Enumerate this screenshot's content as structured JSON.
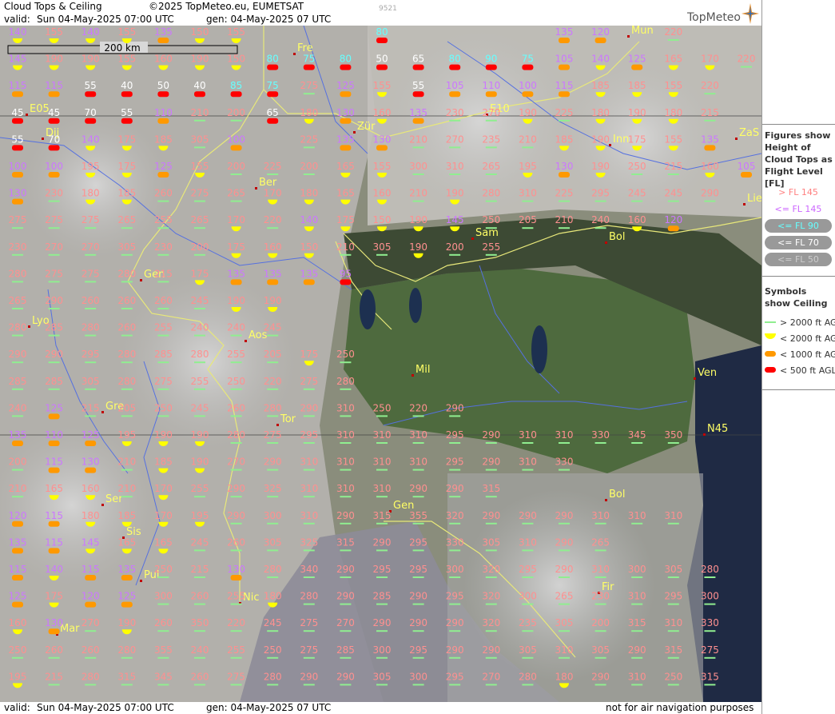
{
  "header": {
    "title": "Cloud Tops & Ceiling",
    "copyright": "©2025 TopMeteo.eu, EUMETSAT",
    "valid_label": "valid:",
    "valid_time": "Sun   04-May-2025   07:00 UTC",
    "gen_time": "gen: 04-May-2025 07 UTC",
    "image_id": "9521",
    "logo": "TopMeteo"
  },
  "footer": {
    "valid_label": "valid:",
    "valid_time": "Sun   04-May-2025   07:00 UTC",
    "gen_time": "gen: 04-May-2025 07 UTC",
    "disclaimer": "not for air navigation purposes"
  },
  "scale_bar": {
    "label": "200 km"
  },
  "legend": {
    "tops_title": "Figures show Height of Cloud Tops as Flight Level  [FL]",
    "tops_items": [
      {
        "label": "> FL 145",
        "color": "#ff8080"
      },
      {
        "label": "<= FL 145",
        "color": "#cc66ff"
      },
      {
        "label": "<= FL 90",
        "color": "#66ffff"
      },
      {
        "label": "<= FL 70",
        "color": "#ffffff"
      },
      {
        "label": "<= FL 50",
        "color": "#cccccc"
      }
    ],
    "ceiling_title": "Symbols show Ceiling",
    "ceiling_items": [
      {
        "label": "> 2000 ft AGL",
        "color": "#90ee90"
      },
      {
        "label": "< 2000 ft AGL",
        "color": "#ffff00"
      },
      {
        "label": "< 1000 ft AGL",
        "color": "#ff9900"
      },
      {
        "label": "< 500 ft AGL",
        "color": "#ff0000"
      }
    ]
  },
  "cities": [
    "Mun",
    "Fre",
    "Dij",
    "Zür",
    "Inn",
    "ZaS",
    "Ber",
    "Lie",
    "Sam",
    "Bol",
    "Gen",
    "Lyo",
    "Aos",
    "Mil",
    "Ven",
    "Gre",
    "Tor",
    "N45",
    "Bol",
    "Ser",
    "Gen",
    "Sis",
    "Pul",
    "Nic",
    "Fir",
    "Mar",
    "E05",
    "E10"
  ],
  "rows": [
    {
      "values": [
        "140",
        "155",
        "140",
        "155",
        "135",
        "150",
        "155",
        "",
        "",
        "",
        "80",
        "",
        "",
        "",
        "",
        "135",
        "120",
        "",
        "220"
      ]
    },
    {
      "values": [
        "145",
        "190",
        "190",
        "155",
        "160",
        "190",
        "150",
        "80",
        "75",
        "80",
        "50",
        "65",
        "80",
        "90",
        "75",
        "105",
        "140",
        "125",
        "165",
        "170",
        "220"
      ]
    },
    {
      "values": [
        "115",
        "115",
        "55",
        "40",
        "50",
        "40",
        "85",
        "75",
        "275",
        "125",
        "155",
        "55",
        "105",
        "110",
        "100",
        "115",
        "185",
        "185",
        "155",
        "220"
      ]
    },
    {
      "values": [
        "45",
        "45",
        "70",
        "55",
        "110",
        "210",
        "200",
        "65",
        "180",
        "130",
        "160",
        "135",
        "230",
        "270",
        "190",
        "225",
        "180",
        "190",
        "180",
        "215"
      ]
    },
    {
      "values": [
        "55",
        "70",
        "140",
        "175",
        "185",
        "305",
        "100",
        "",
        "225",
        "135",
        "130",
        "210",
        "270",
        "235",
        "210",
        "185",
        "190",
        "175",
        "155",
        "135"
      ]
    },
    {
      "values": [
        "100",
        "100",
        "195",
        "175",
        "125",
        "155",
        "200",
        "225",
        "200",
        "165",
        "155",
        "300",
        "310",
        "265",
        "195",
        "130",
        "190",
        "250",
        "215",
        "160",
        "105"
      ]
    },
    {
      "values": [
        "130",
        "230",
        "180",
        "185",
        "260",
        "275",
        "265",
        "170",
        "180",
        "165",
        "160",
        "210",
        "190",
        "280",
        "310",
        "225",
        "295",
        "245",
        "245",
        "290"
      ]
    },
    {
      "values": [
        "275",
        "275",
        "275",
        "265",
        "255",
        "265",
        "170",
        "220",
        "140",
        "175",
        "150",
        "190",
        "145",
        "250",
        "205",
        "210",
        "240",
        "160",
        "120"
      ]
    },
    {
      "values": [
        "230",
        "270",
        "270",
        "305",
        "230",
        "200",
        "175",
        "160",
        "150",
        "210",
        "305",
        "190",
        "200",
        "255"
      ]
    },
    {
      "values": [
        "280",
        "275",
        "275",
        "280",
        "215",
        "175",
        "135",
        "135",
        "135",
        "95"
      ]
    },
    {
      "values": [
        "265",
        "290",
        "260",
        "260",
        "260",
        "245",
        "190",
        "190"
      ]
    },
    {
      "values": [
        "280",
        "285",
        "280",
        "260",
        "255",
        "240",
        "240",
        "245"
      ]
    },
    {
      "values": [
        "290",
        "290",
        "295",
        "280",
        "285",
        "280",
        "255",
        "205",
        "175",
        "250"
      ]
    },
    {
      "values": [
        "285",
        "285",
        "305",
        "280",
        "275",
        "255",
        "250",
        "220",
        "275",
        "280"
      ]
    },
    {
      "values": [
        "240",
        "125",
        "215",
        "205",
        "250",
        "245",
        "260",
        "280",
        "290",
        "310",
        "250",
        "220",
        "290"
      ]
    },
    {
      "values": [
        "135",
        "110",
        "125",
        "195",
        "190",
        "190",
        "280",
        "275",
        "295",
        "310",
        "310",
        "310",
        "295",
        "290",
        "310",
        "310",
        "330",
        "345",
        "350"
      ]
    },
    {
      "values": [
        "200",
        "115",
        "130",
        "210",
        "185",
        "190",
        "270",
        "290",
        "310",
        "310",
        "310",
        "310",
        "295",
        "290",
        "310",
        "330"
      ]
    },
    {
      "values": [
        "210",
        "165",
        "160",
        "210",
        "170",
        "255",
        "290",
        "325",
        "310",
        "310",
        "310",
        "290",
        "290",
        "315"
      ]
    },
    {
      "values": [
        "120",
        "115",
        "180",
        "185",
        "170",
        "195",
        "290",
        "300",
        "310",
        "290",
        "315",
        "355",
        "320",
        "290",
        "290",
        "290",
        "310",
        "310",
        "310"
      ]
    },
    {
      "values": [
        "135",
        "115",
        "145",
        "165",
        "165",
        "245",
        "260",
        "305",
        "325",
        "315",
        "290",
        "295",
        "330",
        "305",
        "310",
        "290",
        "265"
      ]
    },
    {
      "values": [
        "115",
        "140",
        "115",
        "135",
        "250",
        "215",
        "130",
        "280",
        "340",
        "290",
        "295",
        "295",
        "300",
        "320",
        "295",
        "290",
        "310",
        "300",
        "305",
        "280"
      ]
    },
    {
      "values": [
        "125",
        "175",
        "120",
        "125",
        "300",
        "260",
        "255",
        "180",
        "280",
        "290",
        "285",
        "290",
        "295",
        "320",
        "300",
        "265",
        "230",
        "310",
        "295",
        "300"
      ]
    },
    {
      "values": [
        "160",
        "130",
        "270",
        "190",
        "260",
        "350",
        "220",
        "245",
        "275",
        "270",
        "290",
        "290",
        "290",
        "320",
        "235",
        "305",
        "200",
        "315",
        "310",
        "330"
      ]
    },
    {
      "values": [
        "250",
        "260",
        "260",
        "280",
        "355",
        "240",
        "255",
        "250",
        "275",
        "285",
        "300",
        "295",
        "290",
        "290",
        "305",
        "310",
        "305",
        "290",
        "315",
        "275"
      ]
    },
    {
      "values": [
        "195",
        "215",
        "280",
        "315",
        "345",
        "260",
        "275",
        "280",
        "290",
        "290",
        "305",
        "300",
        "295",
        "270",
        "280",
        "180",
        "290",
        "310",
        "250",
        "315"
      ]
    }
  ]
}
